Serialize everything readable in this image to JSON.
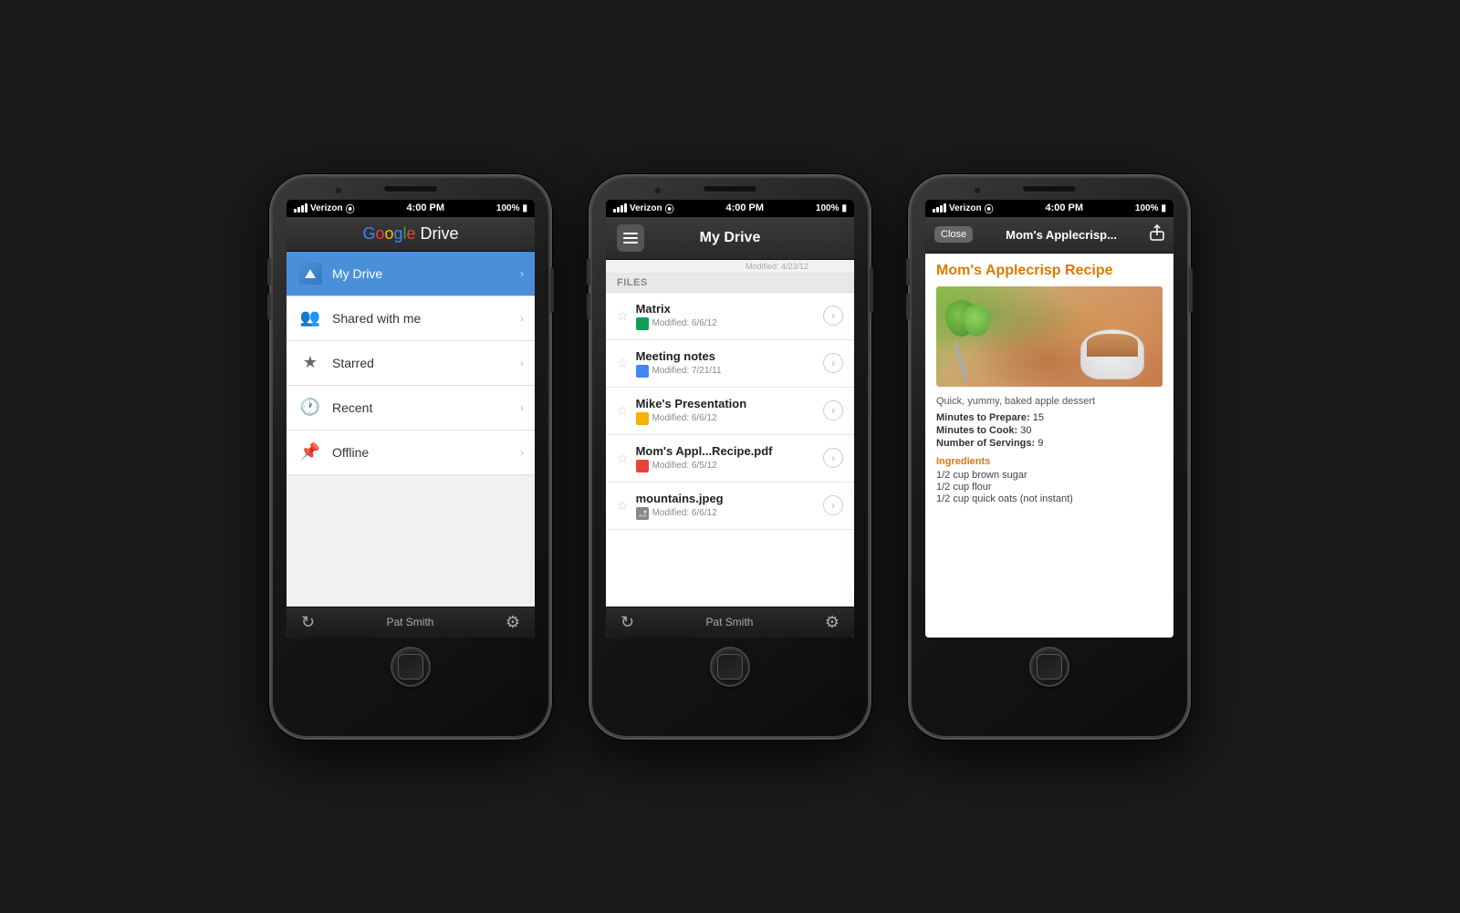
{
  "phones": {
    "phone1": {
      "status": {
        "carrier": "Verizon",
        "wifi": "WiFi",
        "time": "4:00 PM",
        "battery": "100%"
      },
      "header": {
        "google": "Google",
        "drive": " Drive"
      },
      "menu": [
        {
          "id": "my-drive",
          "label": "My Drive",
          "icon": "drive",
          "active": true
        },
        {
          "id": "shared",
          "label": "Shared with me",
          "icon": "people",
          "active": false
        },
        {
          "id": "starred",
          "label": "Starred",
          "icon": "star",
          "active": false
        },
        {
          "id": "recent",
          "label": "Recent",
          "icon": "clock",
          "active": false
        },
        {
          "id": "offline",
          "label": "Offline",
          "icon": "pin",
          "active": false
        }
      ],
      "bottom": {
        "user": "Pat Smith"
      }
    },
    "phone2": {
      "status": {
        "carrier": "Verizon",
        "wifi": "WiFi",
        "time": "4:00 PM",
        "battery": "100%"
      },
      "header": {
        "title": "My Drive"
      },
      "files_label": "FILES",
      "files_modified_above": "Modified: 4/23/12",
      "files": [
        {
          "id": "matrix",
          "name": "Matrix",
          "type": "sheets",
          "modified": "Modified: 6/6/12"
        },
        {
          "id": "meeting-notes",
          "name": "Meeting notes",
          "type": "docs",
          "modified": "Modified: 7/21/11"
        },
        {
          "id": "mikes-presentation",
          "name": "Mike's Presentation",
          "type": "slides",
          "modified": "Modified: 6/6/12"
        },
        {
          "id": "moms-recipe",
          "name": "Mom's Appl...Recipe.pdf",
          "type": "pdf",
          "modified": "Modified: 6/5/12"
        },
        {
          "id": "mountains",
          "name": "mountains.jpeg",
          "type": "image",
          "modified": "Modified: 6/6/12"
        }
      ],
      "bottom": {
        "user": "Pat Smith"
      }
    },
    "phone3": {
      "status": {
        "carrier": "Verizon",
        "wifi": "WiFi",
        "time": "4:00 PM",
        "battery": "100%"
      },
      "header": {
        "close_label": "Close",
        "title": "Mom's Applecrisp...",
        "share_icon": "↑"
      },
      "recipe": {
        "title": "Mom's Applecrisp Recipe",
        "description": "Quick, yummy, baked apple dessert",
        "prepare_label": "Minutes to Prepare:",
        "prepare_value": "15",
        "cook_label": "Minutes to Cook:",
        "cook_value": "30",
        "servings_label": "Number of Servings:",
        "servings_value": "9",
        "ingredients_title": "Ingredients",
        "ingredients": [
          "1/2 cup brown sugar",
          "1/2 cup flour",
          "1/2 cup quick oats (not instant)"
        ]
      }
    }
  }
}
